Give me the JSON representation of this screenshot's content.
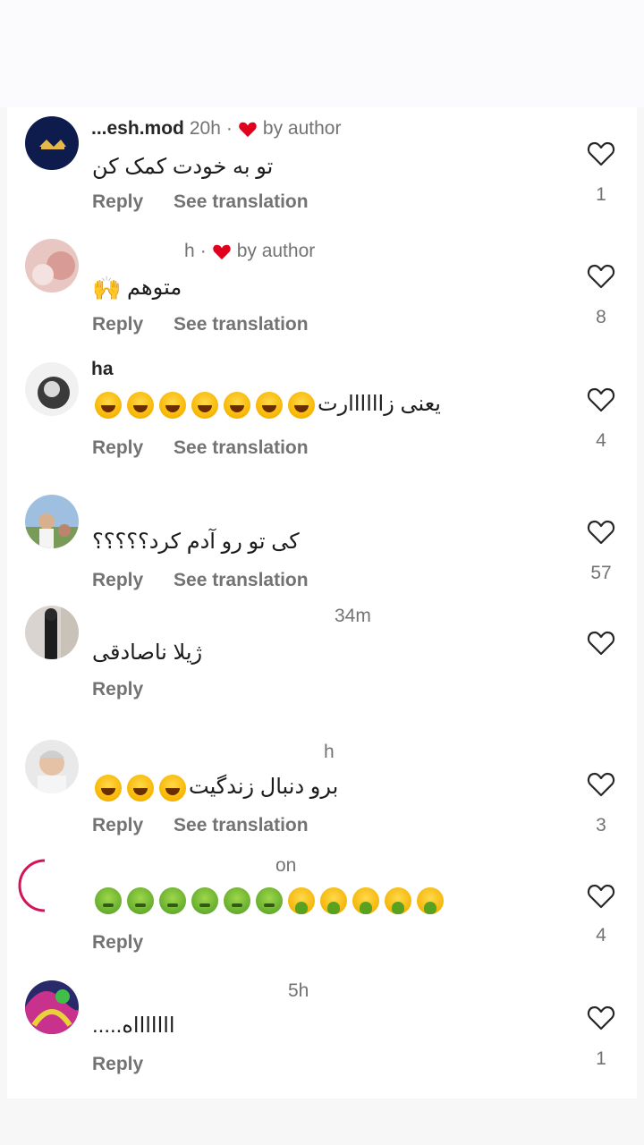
{
  "colors": {
    "accent_heart": "#e0001e",
    "muted": "#737373",
    "text": "#1c1c1c"
  },
  "comments": [
    {
      "username": "...esh.mod",
      "time": "20h",
      "liked_by_author": true,
      "by_author_label": "by author",
      "text": "تو به خودت کمک کن",
      "reply": "Reply",
      "translate": "See translation",
      "likes": "1"
    },
    {
      "username": "",
      "time": "h",
      "liked_by_author": true,
      "by_author_label": "by author",
      "text": "متوهم",
      "emoji": "🙌",
      "reply": "Reply",
      "translate": "See translation",
      "likes": "8"
    },
    {
      "username": "ha",
      "time": "",
      "text": "یعنی زاااااارت",
      "reply": "Reply",
      "translate": "See translation",
      "likes": "4"
    },
    {
      "username": "",
      "time": "",
      "text": "کی تو رو آدم کرد؟؟؟؟؟",
      "reply": "Reply",
      "translate": "See translation",
      "likes": "57"
    },
    {
      "username": "",
      "time": "34m",
      "text": "ژیلا ناصادقی",
      "reply": "Reply",
      "likes": ""
    },
    {
      "username": "",
      "time": "h",
      "text": "برو دنبال زندگیت",
      "reply": "Reply",
      "translate": "See translation",
      "likes": "3"
    },
    {
      "username": "",
      "time": "on",
      "text": "",
      "reply": "Reply",
      "likes": "4"
    },
    {
      "username": "",
      "time": "5h",
      "text": "اااااااه.....",
      "reply": "Reply",
      "likes": "1"
    }
  ]
}
